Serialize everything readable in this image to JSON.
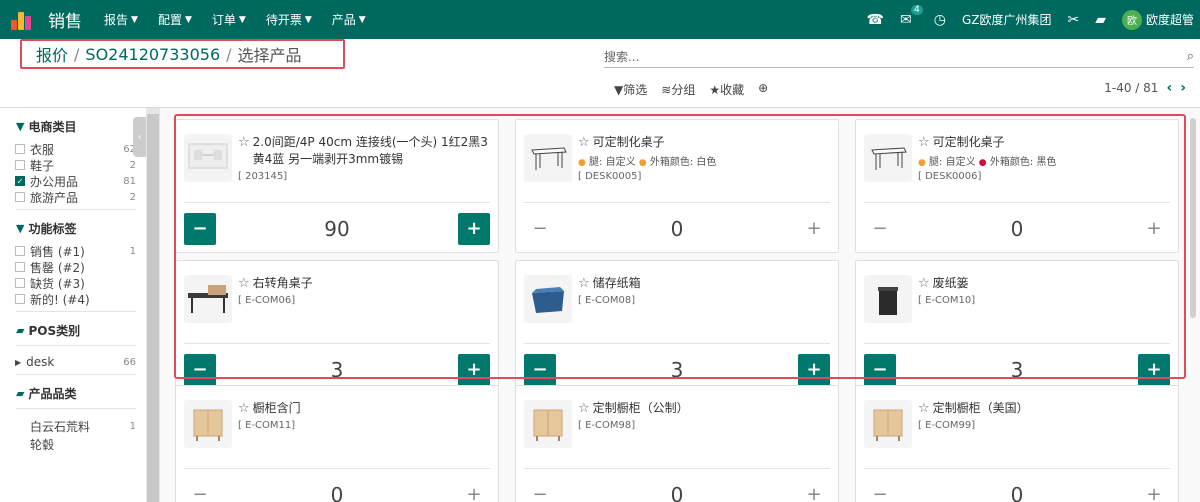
{
  "topbar": {
    "app_name": "销售",
    "menu": [
      {
        "label": "报告"
      },
      {
        "label": "配置"
      },
      {
        "label": "订单"
      },
      {
        "label": "待开票"
      },
      {
        "label": "产品"
      }
    ],
    "chat_badge": "4",
    "company": "GZ欧度广州集团",
    "avatar_initial": "欧",
    "user_name": "欧度超管"
  },
  "control": {
    "breadcrumb": [
      "报价",
      "SO24120733056",
      "选择产品"
    ],
    "search_placeholder": "搜索...",
    "filter_label": "筛选",
    "group_label": "分组",
    "favorite_label": "收藏",
    "pager": "1-40 / 81"
  },
  "sidebar": {
    "sections": [
      {
        "title": "电商类目",
        "icon": "filter-icon",
        "items": [
          {
            "label": "衣服",
            "count": "62",
            "checked": false
          },
          {
            "label": "鞋子",
            "count": "2",
            "checked": false
          },
          {
            "label": "办公用品",
            "count": "81",
            "checked": true
          },
          {
            "label": "旅游产品",
            "count": "2",
            "checked": false
          }
        ]
      },
      {
        "title": "功能标签",
        "icon": "filter-icon",
        "items": [
          {
            "label": "销售 (#1)",
            "count": "1",
            "checked": false
          },
          {
            "label": "售罄 (#2)",
            "count": "",
            "checked": false
          },
          {
            "label": "缺货 (#3)",
            "count": "",
            "checked": false
          },
          {
            "label": "新的! (#4)",
            "count": "",
            "checked": false
          }
        ]
      },
      {
        "title": "POS类别",
        "icon": "folder-icon",
        "items": [
          {
            "label": "desk",
            "count": "66",
            "checked": false,
            "tree": true
          }
        ]
      },
      {
        "title": "产品品类",
        "icon": "folder-icon",
        "items": [
          {
            "label": "白云石荒料",
            "count": "1",
            "checked": false,
            "plain": true
          },
          {
            "label": "轮毂",
            "count": "",
            "checked": false,
            "plain": true
          }
        ]
      }
    ]
  },
  "products": [
    {
      "name": "2.0间距/4P 40cm 连接线(一个头) 1红2黑3黄4蓝 另一端剥开3mm镀锡",
      "code": "[ 203145]",
      "attrs": [],
      "qty": "90",
      "active": true,
      "img": "cable"
    },
    {
      "name": "可定制化桌子",
      "code": "[ DESK0005]",
      "attrs": [
        {
          "text": "腿: 自定义",
          "color": "#f0a030"
        },
        {
          "text": "外箱颜色: 白色",
          "color": "#f0a030"
        }
      ],
      "qty": "0",
      "active": false,
      "img": "desk"
    },
    {
      "name": "可定制化桌子",
      "code": "[ DESK0006]",
      "attrs": [
        {
          "text": "腿: 自定义",
          "color": "#f0a030"
        },
        {
          "text": "外箱颜色: 黑色",
          "color": "#d0103a"
        }
      ],
      "qty": "0",
      "active": false,
      "img": "desk"
    },
    {
      "name": "右转角桌子",
      "code": "[ E-COM06]",
      "attrs": [],
      "qty": "3",
      "active": true,
      "img": "corner"
    },
    {
      "name": "储存纸箱",
      "code": "[ E-COM08]",
      "attrs": [],
      "qty": "3",
      "active": true,
      "img": "box"
    },
    {
      "name": "废纸篓",
      "code": "[ E-COM10]",
      "attrs": [],
      "qty": "3",
      "active": true,
      "img": "bin"
    },
    {
      "name": "橱柜含门",
      "code": "[ E-COM11]",
      "attrs": [],
      "qty": "0",
      "active": false,
      "img": "cabinet"
    },
    {
      "name": "定制橱柜（公制）",
      "code": "[ E-COM98]",
      "attrs": [],
      "qty": "0",
      "active": false,
      "img": "cabinet"
    },
    {
      "name": "定制橱柜（美国）",
      "code": "[ E-COM99]",
      "attrs": [],
      "qty": "0",
      "active": false,
      "img": "cabinet"
    }
  ],
  "colors": {
    "brand": "#00695f",
    "button": "#00786c",
    "highlight": "#e04b5c"
  }
}
